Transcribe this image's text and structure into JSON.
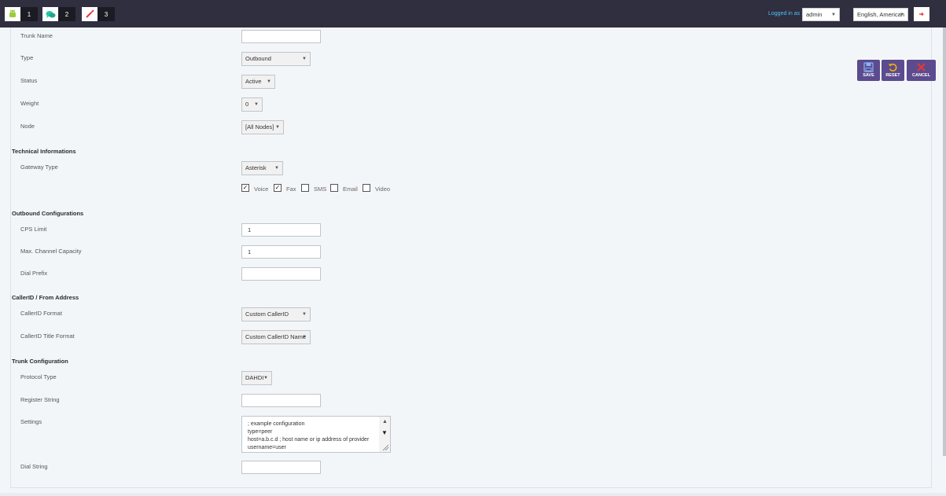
{
  "topbar": {
    "badges": [
      {
        "count": "1",
        "icon": "android-icon",
        "color": "#9ccc3c"
      },
      {
        "count": "2",
        "icon": "chat-icon",
        "color": "#27c4a6"
      },
      {
        "count": "3",
        "icon": "tools-icon",
        "color": "#e53935"
      }
    ],
    "logged_in_label": "Logged in as :",
    "user": "admin",
    "language": "English, American",
    "logout_icon": "logout-icon"
  },
  "actions": {
    "save": "SAVE",
    "reset": "RESET",
    "cancel": "CANCEL"
  },
  "form": {
    "trunk_name": {
      "label": "Trunk Name",
      "value": ""
    },
    "type": {
      "label": "Type",
      "value": "Outbound"
    },
    "status": {
      "label": "Status",
      "value": "Active"
    },
    "weight": {
      "label": "Weight",
      "value": "0"
    },
    "node": {
      "label": "Node",
      "value": "[All Nodes]"
    },
    "technical_section": "Technical Informations",
    "gateway_type": {
      "label": "Gateway Type",
      "value": "Asterisk"
    },
    "media": [
      {
        "label": "Voice",
        "checked": true
      },
      {
        "label": "Fax",
        "checked": true
      },
      {
        "label": "SMS",
        "checked": false
      },
      {
        "label": "Email",
        "checked": false
      },
      {
        "label": "Video",
        "checked": false
      }
    ],
    "outbound_section": "Outbound Configurations",
    "cps_limit": {
      "label": "CPS Limit",
      "value": "1"
    },
    "max_channel": {
      "label": "Max. Channel Capacity",
      "value": "1"
    },
    "dial_prefix": {
      "label": "Dial Prefix",
      "value": ""
    },
    "callerid_section": "CallerID / From Address",
    "callerid_format": {
      "label": "CallerID Format",
      "value": "Custom CallerID"
    },
    "callerid_title_format": {
      "label": "CallerID Title Format",
      "value": "Custom CallerID Name"
    },
    "trunk_section": "Trunk Configuration",
    "protocol_type": {
      "label": "Protocol Type",
      "value": "DAHDI"
    },
    "register_string": {
      "label": "Register String",
      "value": ""
    },
    "settings": {
      "label": "Settings",
      "lines": [
        "; example configuration",
        "type=peer",
        "host=a.b.c.d ; host name or ip address of provider",
        "username=user"
      ]
    },
    "dial_string": {
      "label": "Dial String",
      "value": ""
    }
  }
}
